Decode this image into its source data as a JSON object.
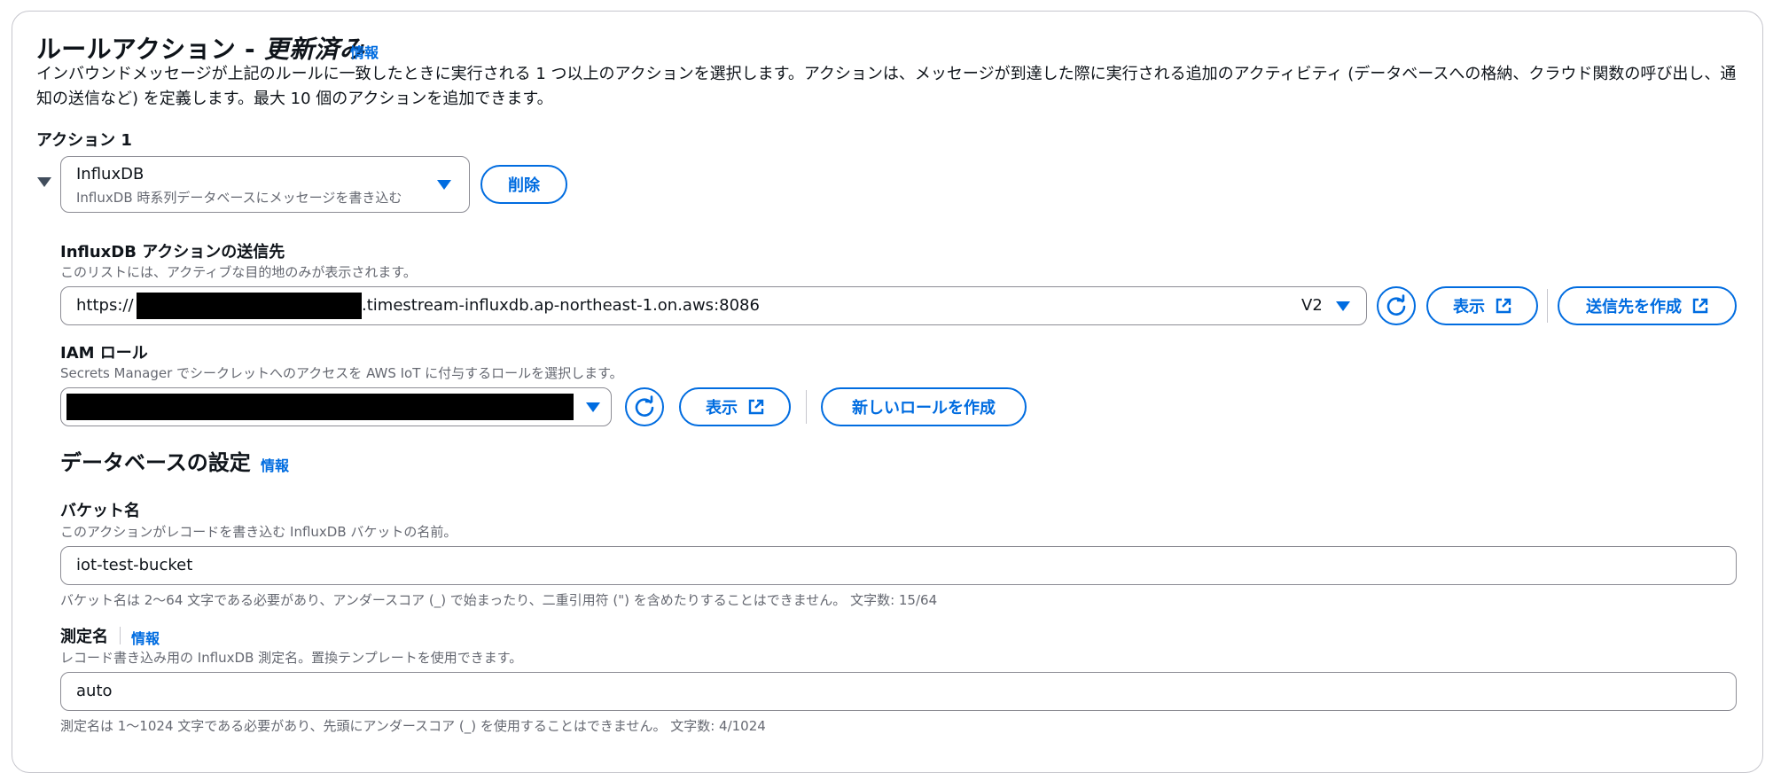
{
  "section": {
    "title_main": "ルールアクション - ",
    "title_emph": "更新済み",
    "info_link": "情報",
    "description": "インバウンドメッセージが上記のルールに一致したときに実行される 1 つ以上のアクションを選択します。アクションは、メッセージが到達した際に実行される追加のアクティビティ (データベースへの格納、クラウド関数の呼び出し、通知の送信など) を定義します。最大 10 個のアクションを追加できます。"
  },
  "action": {
    "label": "アクション 1",
    "select_title": "InfluxDB",
    "select_subtitle": "InfluxDB 時系列データベースにメッセージを書き込む",
    "delete_label": "削除"
  },
  "destination": {
    "label": "InfluxDB アクションの送信先",
    "sublabel": "このリストには、アクティブな目的地のみが表示されます。",
    "url_prefix": "https://",
    "url_suffix": ".timestream-influxdb.ap-northeast-1.on.aws:8086",
    "version": "V2",
    "view_label": "表示",
    "create_label": "送信先を作成"
  },
  "iam": {
    "label": "IAM ロール",
    "sublabel": "Secrets Manager でシークレットへのアクセスを AWS IoT に付与するロールを選択します。",
    "view_label": "表示",
    "create_label": "新しいロールを作成"
  },
  "db_settings": {
    "title": "データベースの設定",
    "info_link": "情報"
  },
  "bucket": {
    "label": "バケット名",
    "sublabel": "このアクションがレコードを書き込む InfluxDB バケットの名前。",
    "value": "iot-test-bucket",
    "hint": "バケット名は 2〜64 文字である必要があり、アンダースコア (_) で始まったり、二重引用符 (\") を含めたりすることはできません。 文字数: 15/64"
  },
  "measurement": {
    "label": "測定名",
    "info_link": "情報",
    "sublabel": "レコード書き込み用の InfluxDB 測定名。置換テンプレートを使用できます。",
    "value": "auto",
    "hint": "測定名は 1〜1024 文字である必要があり、先頭にアンダースコア (_) を使用することはできません。 文字数: 4/1024"
  },
  "colors": {
    "accent": "#006ce0",
    "text": "#0f141a",
    "muted": "#656871",
    "border": "#8c8c94"
  },
  "icons": [
    "expand-caret-icon",
    "dropdown-caret-icon",
    "refresh-icon",
    "external-link-icon"
  ]
}
